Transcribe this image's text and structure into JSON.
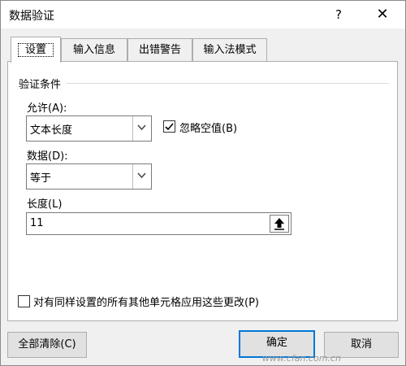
{
  "window": {
    "title": "数据验证",
    "help": "?",
    "close": "✕"
  },
  "tabs": [
    {
      "label": "设置"
    },
    {
      "label": "输入信息"
    },
    {
      "label": "出错警告"
    },
    {
      "label": "输入法模式"
    }
  ],
  "settings": {
    "group_title": "验证条件",
    "allow_label": "允许(A):",
    "allow_value": "文本长度",
    "ignore_blank_label": "忽略空值(B)",
    "ignore_blank_checked": true,
    "data_label": "数据(D):",
    "data_value": "等于",
    "length_label": "长度(L)",
    "length_value": "11",
    "apply_all_label": "对有同样设置的所有其他单元格应用这些更改(P)",
    "apply_all_checked": false
  },
  "buttons": {
    "clear_all": "全部清除(C)",
    "ok": "确定",
    "cancel": "取消"
  },
  "watermark": "www.cfan.com.cn",
  "colors": {
    "accent": "#0078d7",
    "panel": "#ffffff",
    "dialog_bg": "#f0f0f0"
  }
}
